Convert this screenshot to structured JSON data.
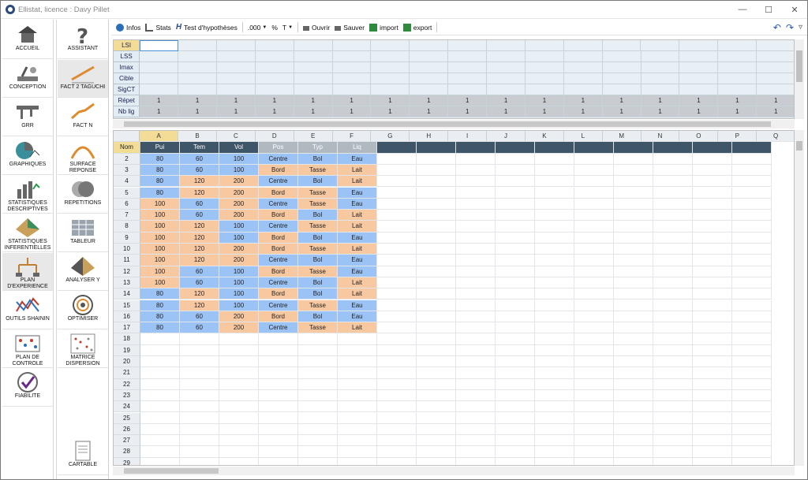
{
  "window": {
    "title": "Ellistat, licence : Davy Pillet"
  },
  "nav_col1": [
    {
      "id": "accueil",
      "label": "ACCUEIL"
    },
    {
      "id": "conception",
      "label": "CONCEPTION"
    },
    {
      "id": "grr",
      "label": "GRR"
    },
    {
      "id": "graphiques",
      "label": "GRAPHIQUES"
    },
    {
      "id": "stat-desc",
      "label": "STATISTIQUES DESCRIPTIVES"
    },
    {
      "id": "stat-inf",
      "label": "STATISTIQUES INFERENTIELLES"
    },
    {
      "id": "plan-exp",
      "label": "PLAN D'EXPERIENCE",
      "selected": true
    },
    {
      "id": "outils-shainin",
      "label": "OUTILS SHAININ"
    },
    {
      "id": "plan-controle",
      "label": "PLAN DE CONTROLE"
    },
    {
      "id": "fiabilite",
      "label": "FIABILITE"
    }
  ],
  "nav_col2": [
    {
      "id": "assistant",
      "label": "ASSISTANT"
    },
    {
      "id": "fact2",
      "label": "FACT 2 TAGUCHI",
      "selected": true
    },
    {
      "id": "factn",
      "label": "FACT N"
    },
    {
      "id": "surface",
      "label": "SURFACE REPONSE"
    },
    {
      "id": "repetitions",
      "label": "REPETITIONS"
    },
    {
      "id": "tableur",
      "label": "TABLEUR"
    },
    {
      "id": "analyser",
      "label": "ANALYSER Y"
    },
    {
      "id": "optimiser",
      "label": "OPTIMISER"
    },
    {
      "id": "matrice",
      "label": "MATRICE DISPERSION"
    },
    {
      "id": "cartable",
      "label": "CARTABLE"
    }
  ],
  "toolbar": {
    "infos": "Infos",
    "stats": "Stats",
    "test": "Test d'hypothèses",
    "decimals": ".000",
    "percent": "%",
    "text": "T",
    "open": "Ouvrir",
    "save": "Sauver",
    "import": "import",
    "export": "export"
  },
  "spec": {
    "labels": [
      "LSI",
      "LSS",
      "Imax",
      "Cible",
      "SigCT",
      "Répet",
      "Nb lig"
    ],
    "repeat_value": "1"
  },
  "grid": {
    "columns": [
      "A",
      "B",
      "C",
      "D",
      "E",
      "F",
      "G",
      "H",
      "I",
      "J",
      "K",
      "L",
      "M",
      "N",
      "O",
      "P",
      "Q"
    ],
    "header_label": "Nom",
    "headers": [
      "Pui",
      "Tem",
      "Vol",
      "Pos",
      "Typ",
      "Liq"
    ],
    "rows": [
      [
        "80",
        "60",
        "100",
        "Centre",
        "Bol",
        "Eau"
      ],
      [
        "80",
        "60",
        "100",
        "Bord",
        "Tasse",
        "Lait"
      ],
      [
        "80",
        "120",
        "200",
        "Centre",
        "Bol",
        "Lait"
      ],
      [
        "80",
        "120",
        "200",
        "Bord",
        "Tasse",
        "Eau"
      ],
      [
        "100",
        "60",
        "200",
        "Centre",
        "Tasse",
        "Eau"
      ],
      [
        "100",
        "60",
        "200",
        "Bord",
        "Bol",
        "Lait"
      ],
      [
        "100",
        "120",
        "100",
        "Centre",
        "Tasse",
        "Lait"
      ],
      [
        "100",
        "120",
        "100",
        "Bord",
        "Bol",
        "Eau"
      ],
      [
        "100",
        "120",
        "200",
        "Bord",
        "Tasse",
        "Lait"
      ],
      [
        "100",
        "120",
        "200",
        "Centre",
        "Bol",
        "Eau"
      ],
      [
        "100",
        "60",
        "100",
        "Bord",
        "Tasse",
        "Eau"
      ],
      [
        "100",
        "60",
        "100",
        "Centre",
        "Bol",
        "Lait"
      ],
      [
        "80",
        "120",
        "100",
        "Bord",
        "Bol",
        "Lait"
      ],
      [
        "80",
        "120",
        "100",
        "Centre",
        "Tasse",
        "Eau"
      ],
      [
        "80",
        "60",
        "200",
        "Bord",
        "Bol",
        "Eau"
      ],
      [
        "80",
        "60",
        "200",
        "Centre",
        "Tasse",
        "Lait"
      ]
    ],
    "row_numbers": [
      "2",
      "3",
      "4",
      "5",
      "6",
      "7",
      "8",
      "9",
      "10",
      "11",
      "12",
      "13",
      "14",
      "15",
      "16",
      "17",
      "18",
      "19",
      "20",
      "21",
      "22",
      "23",
      "24",
      "25",
      "26",
      "27",
      "28",
      "29"
    ],
    "colors": {
      "blue": "#9cc3f5",
      "orange": "#f8c8a0",
      "header_dark": "#3f5568"
    }
  }
}
